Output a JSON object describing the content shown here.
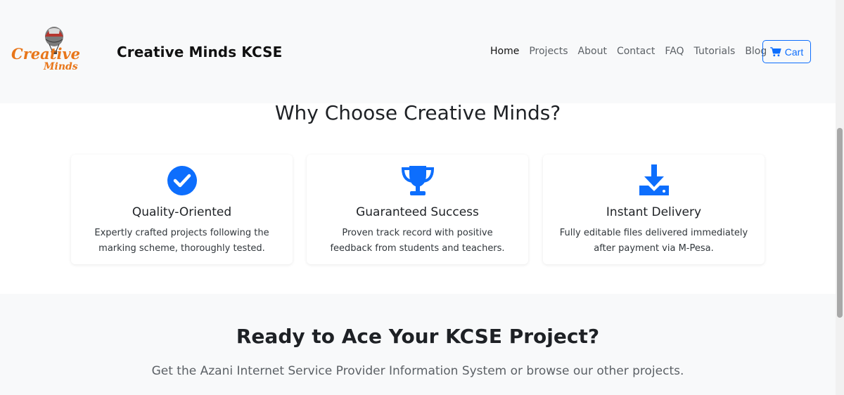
{
  "navbar": {
    "logo": {
      "word1": "Creative",
      "word2": "Minds"
    },
    "brand": "Creative Minds KCSE",
    "links": [
      {
        "label": "Home",
        "active": true
      },
      {
        "label": "Projects"
      },
      {
        "label": "About"
      },
      {
        "label": "Contact"
      },
      {
        "label": "FAQ"
      },
      {
        "label": "Tutorials"
      },
      {
        "label": "Blog"
      }
    ],
    "cart_label": "Cart"
  },
  "features": {
    "title": "Why Choose Creative Minds?",
    "cards": [
      {
        "icon": "check-circle-icon",
        "title": "Quality-Oriented",
        "text": "Expertly crafted projects following the marking scheme, thoroughly tested."
      },
      {
        "icon": "trophy-icon",
        "title": "Guaranteed Success",
        "text": "Proven track record with positive feedback from students and teachers."
      },
      {
        "icon": "download-icon",
        "title": "Instant Delivery",
        "text": "Fully editable files delivered immediately after payment via M-Pesa."
      }
    ]
  },
  "cta": {
    "title": "Ready to Ace Your KCSE Project?",
    "subtitle": "Get the Azani Internet Service Provider Information System or browse our other projects."
  },
  "colors": {
    "accent": "#0d6efd",
    "logo_orange": "#e8761a",
    "nav_bg": "#f8f9fa"
  }
}
